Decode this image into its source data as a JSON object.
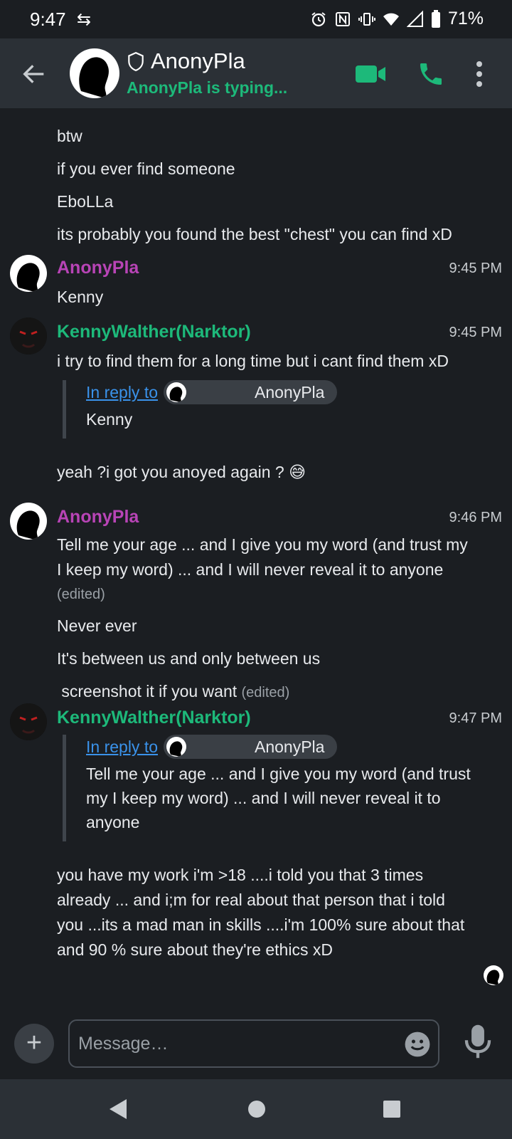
{
  "status_bar": {
    "time": "9:47",
    "battery": "71%"
  },
  "header": {
    "contact_name": "AnonyPla",
    "typing_status": "AnonyPla is typing..."
  },
  "messages_top": [
    {
      "text": "btw"
    },
    {
      "text": "if you ever find someone"
    },
    {
      "text": "EboLLa"
    },
    {
      "text": "its probably you found the best \"chest\" you can find xD"
    }
  ],
  "block1": {
    "author": "AnonyPla",
    "time": "9:45 PM",
    "text": "Kenny"
  },
  "block2": {
    "author": "KennyWalther(Narktor)",
    "time": "9:45 PM",
    "text": "i try to find them for a long time but i cant find them xD",
    "reply_link": "In reply to",
    "reply_author": "AnonyPla",
    "reply_text": "Kenny",
    "text2": "yeah ?i got you anoyed again ? 😅"
  },
  "block3": {
    "author": "AnonyPla",
    "time": "9:46 PM",
    "text_line1": "Tell me your age ... and I give you my word (and trust my",
    "text_line2": "I keep my word) ... and I will never reveal it to anyone",
    "edited": "(edited)",
    "text2": "Never ever",
    "text3": "It's between us and only between us",
    "text4": " screenshot it if you want",
    "edited2": "(edited)"
  },
  "block4": {
    "author": "KennyWalther(Narktor)",
    "time": "9:47 PM",
    "reply_link": "In reply to",
    "reply_author": "AnonyPla",
    "reply_line1": "Tell me your age ... and I give you my word (and trust",
    "reply_line2": "my I keep my word) ... and I will never reveal it to",
    "reply_line3": "anyone",
    "text_line1": "you have my work i'm >18 ....i told you that 3 times",
    "text_line2": "already ... and i;m for real about that person that i told",
    "text_line3": "you ...its a mad man in skills ....i'm 100% sure about that",
    "text_line4": "and 90 % sure about they're ethics xD"
  },
  "composer": {
    "placeholder": "Message…"
  },
  "colors": {
    "accent_green": "#1db97a",
    "author_pink": "#b844b6",
    "link_blue": "#3a92ea"
  }
}
